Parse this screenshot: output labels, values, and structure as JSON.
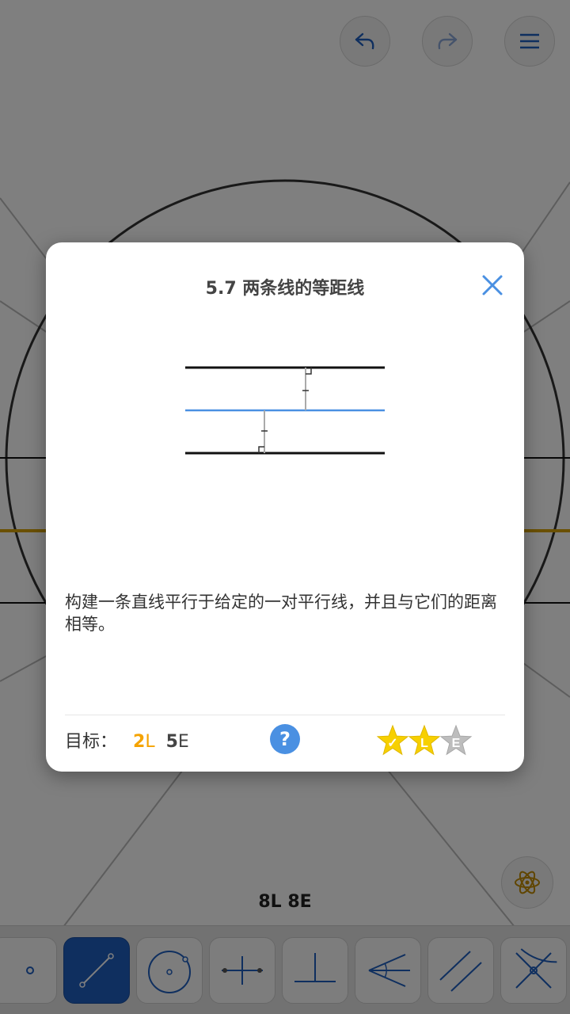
{
  "dialog": {
    "title": "5.7 两条线的等距线",
    "description": "构建一条直线平行于给定的一对平行线，并且与它们的距离相等。",
    "goal_label": "目标：",
    "goal_L_num": "2",
    "goal_L_suffix": "L",
    "goal_E_num": "5",
    "goal_E_suffix": "E",
    "help_label": "?",
    "stars": [
      {
        "letter": "✓",
        "earned": true
      },
      {
        "letter": "L",
        "earned": true
      },
      {
        "letter": "E",
        "earned": false
      }
    ]
  },
  "moves_counter": "8L  8E",
  "icons": {
    "undo": "undo-icon",
    "redo": "redo-icon",
    "menu": "menu-icon",
    "atom": "atom-icon",
    "close": "close-icon"
  },
  "toolbar": {
    "tools": [
      {
        "name": "point-tool",
        "active": false
      },
      {
        "name": "line-tool",
        "active": true
      },
      {
        "name": "circle-tool",
        "active": false
      },
      {
        "name": "perpendicular-bisector-tool",
        "active": false
      },
      {
        "name": "perpendicular-tool",
        "active": false
      },
      {
        "name": "angle-bisector-tool",
        "active": false
      },
      {
        "name": "parallel-tool",
        "active": false
      },
      {
        "name": "intersection-tool",
        "active": false
      }
    ]
  },
  "colors": {
    "accent_blue": "#4a90e2",
    "active_tool": "#1f5fbf",
    "goal_gold": "#f5a300",
    "star_gold": "#f7d000",
    "star_gray": "#bdbdbd",
    "background_line_gold": "#d4a000"
  }
}
